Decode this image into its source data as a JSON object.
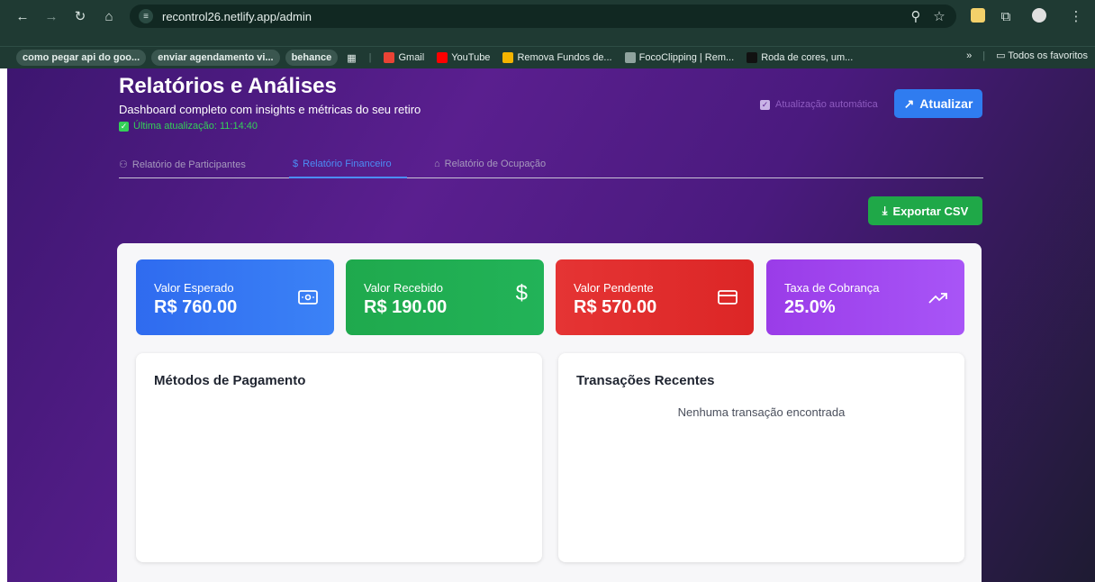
{
  "browser": {
    "url": "recontrol26.netlify.app/admin",
    "bookmarks": [
      {
        "label": "como pegar api do goo...",
        "style": "chip"
      },
      {
        "label": "enviar agendamento vi...",
        "style": "chip"
      },
      {
        "label": "behance",
        "style": "chip"
      },
      {
        "label": "Gmail",
        "style": "plain"
      },
      {
        "label": "YouTube",
        "style": "plain"
      },
      {
        "label": "Remova Fundos de...",
        "style": "plain"
      },
      {
        "label": "FocoClipping | Rem...",
        "style": "plain"
      },
      {
        "label": "Roda de cores, um...",
        "style": "plain"
      }
    ],
    "all_bookmarks_label": "Todos os favoritos",
    "overflow_label": "»"
  },
  "header": {
    "title": "Relatórios e Análises",
    "subtitle": "Dashboard completo com insights e métricas do seu retiro",
    "last_update": "Última atualização: 11:14:40",
    "auto_update_label": "Atualização automática",
    "update_button": "Atualizar"
  },
  "tabs": [
    {
      "label": "Relatório de Participantes",
      "icon": "users-icon",
      "active": false
    },
    {
      "label": "Relatório Financeiro",
      "icon": "dollar-icon",
      "active": true
    },
    {
      "label": "Relatório de Ocupação",
      "icon": "home-icon",
      "active": false
    }
  ],
  "export_button": "Exportar CSV",
  "stats": [
    {
      "label": "Valor Esperado",
      "value": "R$ 760.00",
      "icon": "banknote-icon",
      "color": "#3b82f6"
    },
    {
      "label": "Valor Recebido",
      "value": "R$ 190.00",
      "icon": "dollar-sign-icon",
      "color": "#22b358"
    },
    {
      "label": "Valor Pendente",
      "value": "R$ 570.00",
      "icon": "credit-card-icon",
      "color": "#dc2626"
    },
    {
      "label": "Taxa de Cobrança",
      "value": "25.0%",
      "icon": "trending-up-icon",
      "color": "#a855f7"
    }
  ],
  "payment_methods": {
    "title": "Métodos de Pagamento"
  },
  "recent_transactions": {
    "title": "Transações Recentes",
    "empty_text": "Nenhuma transação encontrada"
  }
}
